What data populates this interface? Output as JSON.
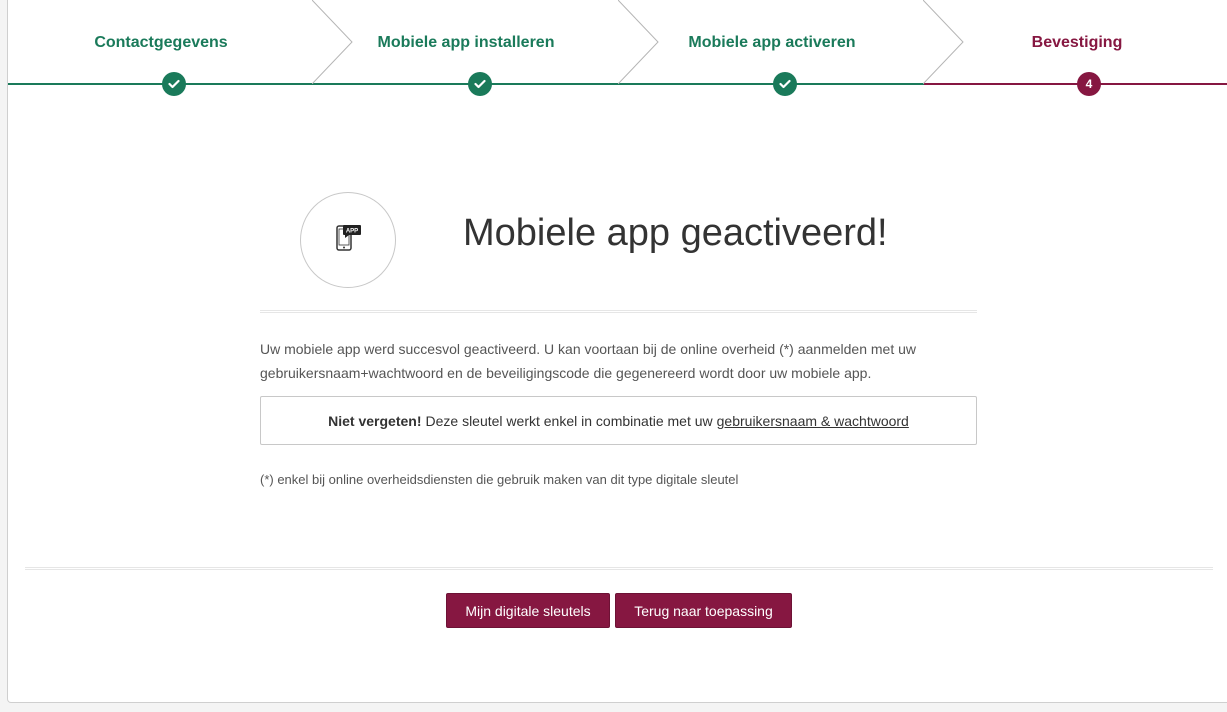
{
  "steps": [
    {
      "label": "Contactgegevens",
      "state": "done"
    },
    {
      "label": "Mobiele app installeren",
      "state": "done"
    },
    {
      "label": "Mobiele app activeren",
      "state": "done"
    },
    {
      "label": "Bevestiging",
      "state": "active",
      "number": "4"
    }
  ],
  "heading": {
    "icon": "mobile-app-icon",
    "icon_text": "APP",
    "title": "Mobiele app geactiveerd!"
  },
  "body": {
    "text": "Uw mobiele app werd succesvol geactiveerd. U kan voortaan bij de online overheid (*) aanmelden met uw gebruikersnaam+wachtwoord en de beveiligingscode die gegenereerd wordt door uw mobiele app."
  },
  "note": {
    "bold": "Niet vergeten!",
    "text": "Deze sleutel werkt enkel in combinatie met uw",
    "link": "gebruikersnaam & wachtwoord"
  },
  "footnote": "(*) enkel bij online overheidsdiensten die gebruik maken van dit type digitale sleutel",
  "buttons": {
    "keys": "Mijn digitale sleutels",
    "back": "Terug naar toepassing"
  },
  "colors": {
    "done": "#1a7a5a",
    "active": "#861741"
  }
}
